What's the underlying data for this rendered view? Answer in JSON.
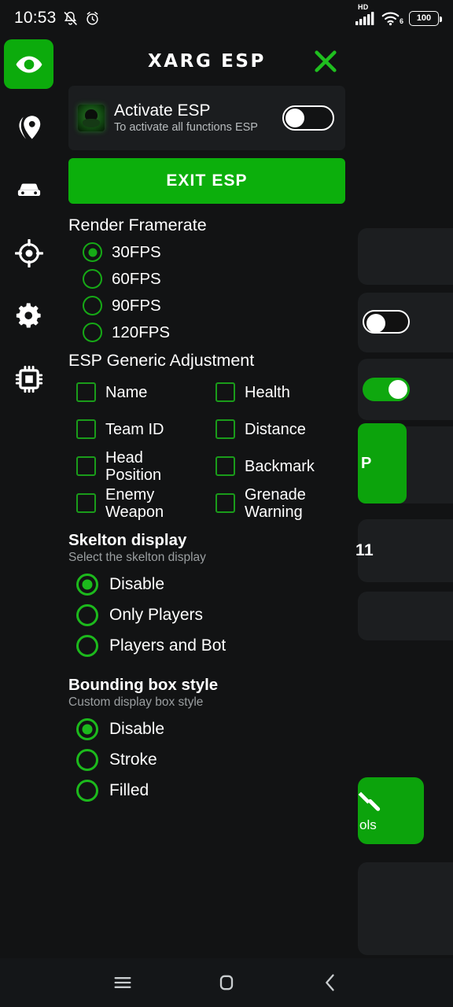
{
  "status_bar": {
    "time": "10:53",
    "icons_left": [
      "mute-bell-icon",
      "alarm-clock-icon"
    ],
    "network_label": "HD",
    "wifi_label": "6",
    "battery_level": "100"
  },
  "sidebar": {
    "items": [
      {
        "name": "esp-eye",
        "icon": "eye-icon",
        "active": true
      },
      {
        "name": "location",
        "icon": "location-pin-icon",
        "active": false
      },
      {
        "name": "vehicle",
        "icon": "car-icon",
        "active": false
      },
      {
        "name": "aim",
        "icon": "crosshair-icon",
        "active": false
      },
      {
        "name": "settings",
        "icon": "gear-icon",
        "active": false
      },
      {
        "name": "memory",
        "icon": "cpu-chip-icon",
        "active": false
      }
    ]
  },
  "header": {
    "title": "XARG ESP",
    "close_icon": "close-x-icon",
    "close_color": "#1fbf1f"
  },
  "activate_card": {
    "icon": "game-avatar-icon",
    "title": "Activate ESP",
    "subtitle": "To activate all functions ESP",
    "toggle_on": false
  },
  "exit_button": {
    "label": "EXIT ESP",
    "color": "#0caf0c"
  },
  "render_framerate": {
    "title": "Render Framerate",
    "options": [
      {
        "label": "30FPS",
        "selected": true
      },
      {
        "label": "60FPS",
        "selected": false
      },
      {
        "label": "90FPS",
        "selected": false
      },
      {
        "label": "120FPS",
        "selected": false
      }
    ]
  },
  "esp_generic_adjustment": {
    "title": "ESP Generic Adjustment",
    "options": [
      {
        "label": "Name",
        "checked": false
      },
      {
        "label": "Health",
        "checked": false
      },
      {
        "label": "Team ID",
        "checked": false
      },
      {
        "label": "Distance",
        "checked": false
      },
      {
        "label": "Head Position",
        "checked": false
      },
      {
        "label": "Backmark",
        "checked": false
      },
      {
        "label": "Enemy Weapon",
        "checked": false
      },
      {
        "label": "Grenade Warning",
        "checked": false
      }
    ]
  },
  "skelton_display": {
    "title": "Skelton display",
    "subtitle": "Select the skelton display",
    "options": [
      {
        "label": "Disable",
        "selected": true
      },
      {
        "label": "Only Players",
        "selected": false
      },
      {
        "label": "Players and Bot",
        "selected": false
      }
    ]
  },
  "bounding_box_style": {
    "title": "Bounding box style",
    "subtitle": "Custom display box style",
    "options": [
      {
        "label": "Disable",
        "selected": true
      },
      {
        "label": "Stroke",
        "selected": false
      },
      {
        "label": "Filled",
        "selected": false
      }
    ]
  },
  "background_app": {
    "green_button_text": "P",
    "number_text": "11",
    "tool_label": "ols"
  },
  "nav_bar": {
    "recents_icon": "menu-lines-icon",
    "home_icon": "home-square-icon",
    "back_icon": "chevron-left-icon"
  },
  "theme": {
    "accent": "#0caf0c",
    "radio_green": "#16a916",
    "panel_bg": "#121314",
    "card_bg": "#1b1d1f"
  }
}
